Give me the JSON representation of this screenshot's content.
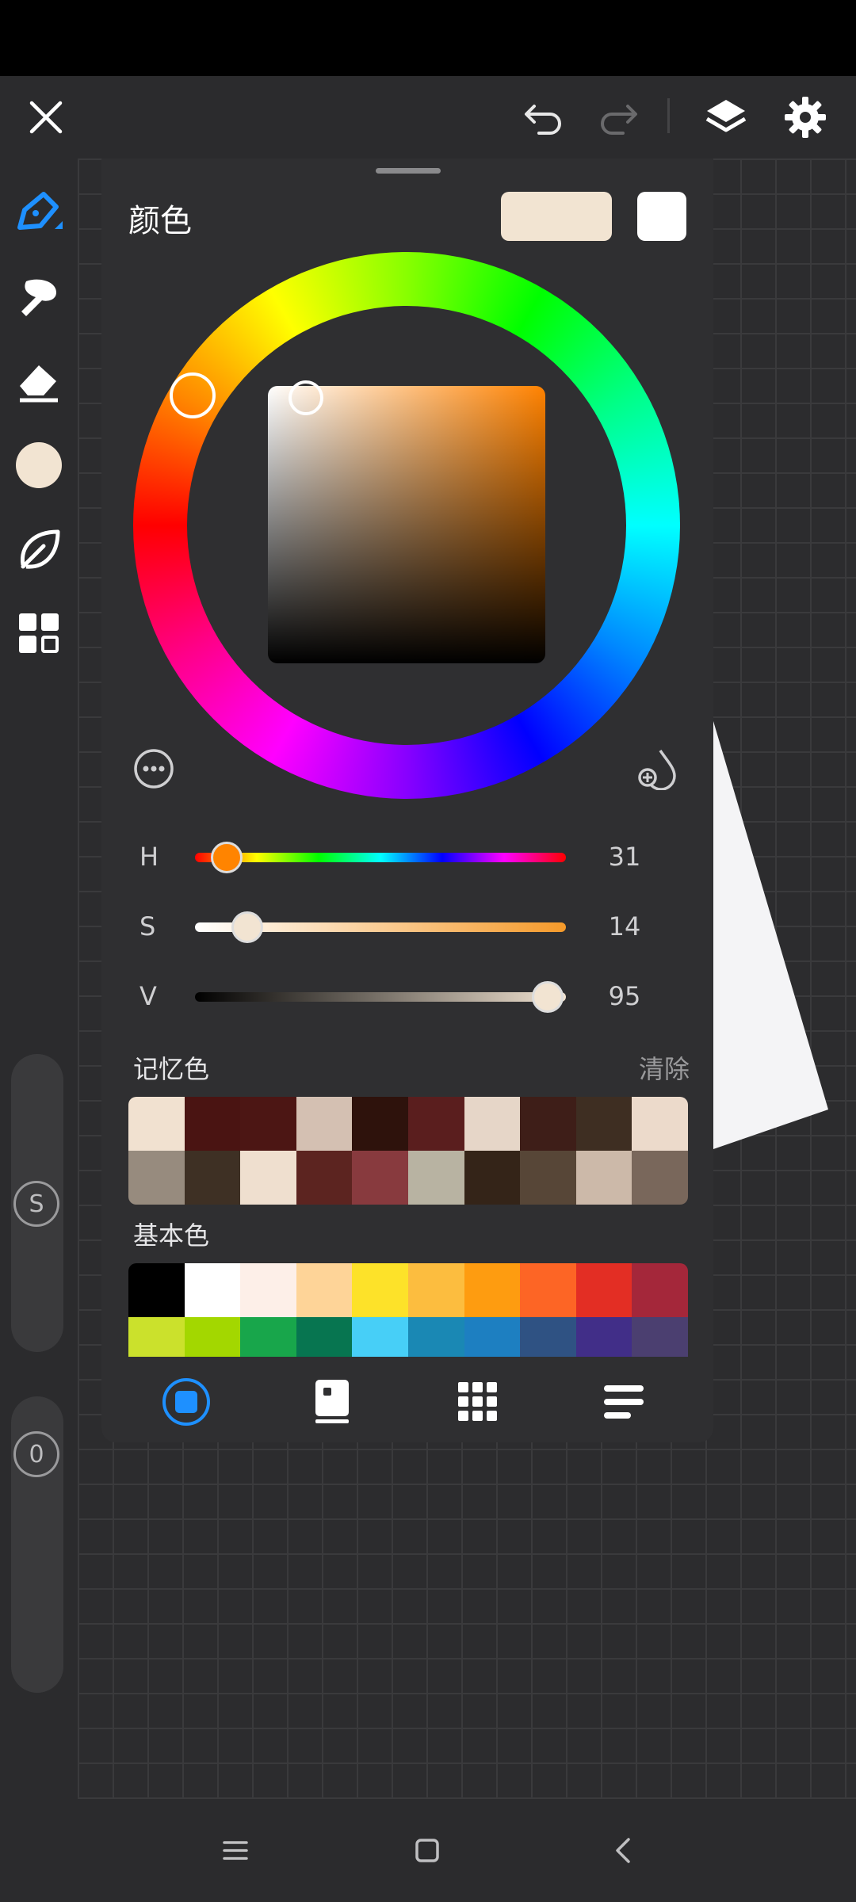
{
  "panel": {
    "title": "颜色",
    "current_color": "#f2e4d2",
    "secondary_color": "#ffffff"
  },
  "sliders": [
    {
      "label": "H",
      "value": "31",
      "fraction": 0.086
    },
    {
      "label": "S",
      "value": "14",
      "fraction": 0.14
    },
    {
      "label": "V",
      "value": "95",
      "fraction": 0.95
    }
  ],
  "memory": {
    "label": "记忆色",
    "clear_label": "清除",
    "colors": [
      "#f1e1d0",
      "#4a1412",
      "#4c1614",
      "#d4c0b2",
      "#2e120c",
      "#5a1e1e",
      "#e6d6c8",
      "#3e1e18",
      "#3e2e22",
      "#ecdacb",
      "#978b7e",
      "#3e3024",
      "#efdfcf",
      "#5c2420",
      "#883a3e",
      "#b8b3a2",
      "#342418",
      "#574637",
      "#ccb9a9",
      "#79675b"
    ]
  },
  "basic": {
    "label": "基本色",
    "colors": [
      "#000000",
      "#ffffff",
      "#fdefe8",
      "#fed498",
      "#fde229",
      "#fcbd3f",
      "#fe9c10",
      "#fd6525",
      "#e32e24",
      "#a4273a",
      "#cbe12c",
      "#a3d700",
      "#18a64b",
      "#077550",
      "#47cff7",
      "#1a88b4",
      "#1d7fc1",
      "#2f5283",
      "#412e88",
      "#4b3f70"
    ]
  },
  "rail": {
    "s_label": "S",
    "o_label": "0",
    "current_color": "#f2e4d2"
  },
  "colors": {
    "accent": "#1e90ff"
  }
}
